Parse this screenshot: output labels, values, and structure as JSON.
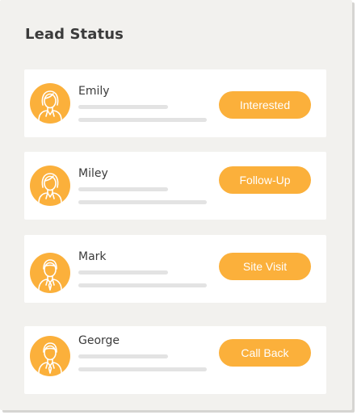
{
  "panel": {
    "title": "Lead Status"
  },
  "colors": {
    "accent": "#fbb03b",
    "panel_background": "#f2f1ee",
    "card_background": "#ffffff",
    "placeholder_line": "#e3e3e3"
  },
  "leads": [
    {
      "name": "Emily",
      "status": "Interested",
      "avatar_icon": "female-user-icon"
    },
    {
      "name": "Miley",
      "status": "Follow-Up",
      "avatar_icon": "female-user-icon"
    },
    {
      "name": "Mark",
      "status": "Site Visit",
      "avatar_icon": "male-user-icon"
    },
    {
      "name": "George",
      "status": "Call Back",
      "avatar_icon": "male-user-icon"
    }
  ]
}
